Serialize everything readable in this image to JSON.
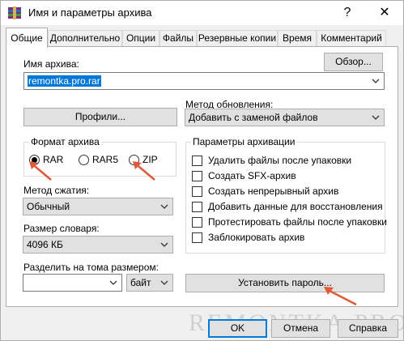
{
  "window": {
    "title": "Имя и параметры архива",
    "help_glyph": "?",
    "close_glyph": "✕"
  },
  "tabs": [
    "Общие",
    "Дополнительно",
    "Опции",
    "Файлы",
    "Резервные копии",
    "Время",
    "Комментарий"
  ],
  "archive_name": {
    "label": "Имя архива:",
    "value": "remontka.pro.rar",
    "browse_label": "Обзор..."
  },
  "profiles_label": "Профили...",
  "update_method": {
    "label": "Метод обновления:",
    "value": "Добавить с заменой файлов"
  },
  "archive_format": {
    "title": "Формат архива",
    "options": [
      "RAR",
      "RAR5",
      "ZIP"
    ],
    "selected": "RAR"
  },
  "compression": {
    "label": "Метод сжатия:",
    "value": "Обычный"
  },
  "dictionary": {
    "label": "Размер словаря:",
    "value": "4096 КБ"
  },
  "split": {
    "label": "Разделить на тома размером:",
    "value": "",
    "unit": "байт"
  },
  "archive_options": {
    "title": "Параметры архивации",
    "items": [
      "Удалить файлы после упаковки",
      "Создать SFX-архив",
      "Создать непрерывный архив",
      "Добавить данные для восстановления",
      "Протестировать файлы после упаковки",
      "Заблокировать архив"
    ]
  },
  "set_password_label": "Установить пароль...",
  "buttons": {
    "ok": "OK",
    "cancel": "Отмена",
    "help": "Справка"
  },
  "watermark": "REMONTKA.PRO",
  "colors": {
    "selection": "#0078d7",
    "annotation_arrow": "#e05a3a"
  }
}
